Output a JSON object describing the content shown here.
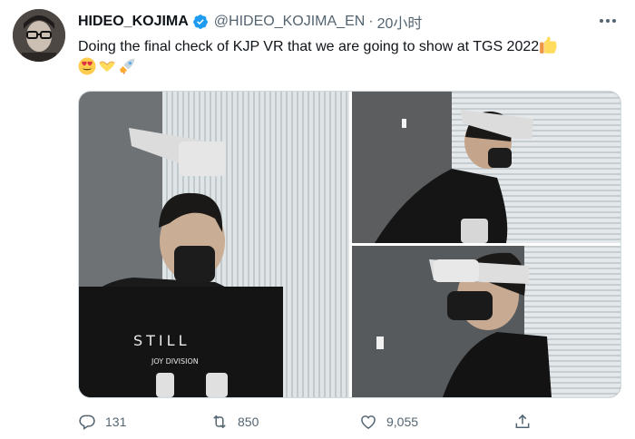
{
  "author": {
    "display_name": "HIDEO_KOJIMA",
    "handle": "@HIDEO_KOJIMA_EN",
    "separator": "·",
    "time": "20小时",
    "verified": true
  },
  "tweet": {
    "text": "Doing the final check of KJP VR that we are going to show at TGS 2022",
    "emojis": [
      "thumbs-up",
      "heart-eyes",
      "heart-hands",
      "rocket"
    ]
  },
  "media": {
    "photos": [
      "photo-left",
      "photo-top-right",
      "photo-bottom-right"
    ],
    "shirt_text_1": "STILL",
    "shirt_text_2": "JOY DIVISION"
  },
  "actions": {
    "reply_count": "131",
    "retweet_count": "850",
    "like_count": "9,055"
  },
  "colors": {
    "verified": "#1d9bf0",
    "secondary_text": "#536471",
    "primary_text": "#0f1419"
  }
}
